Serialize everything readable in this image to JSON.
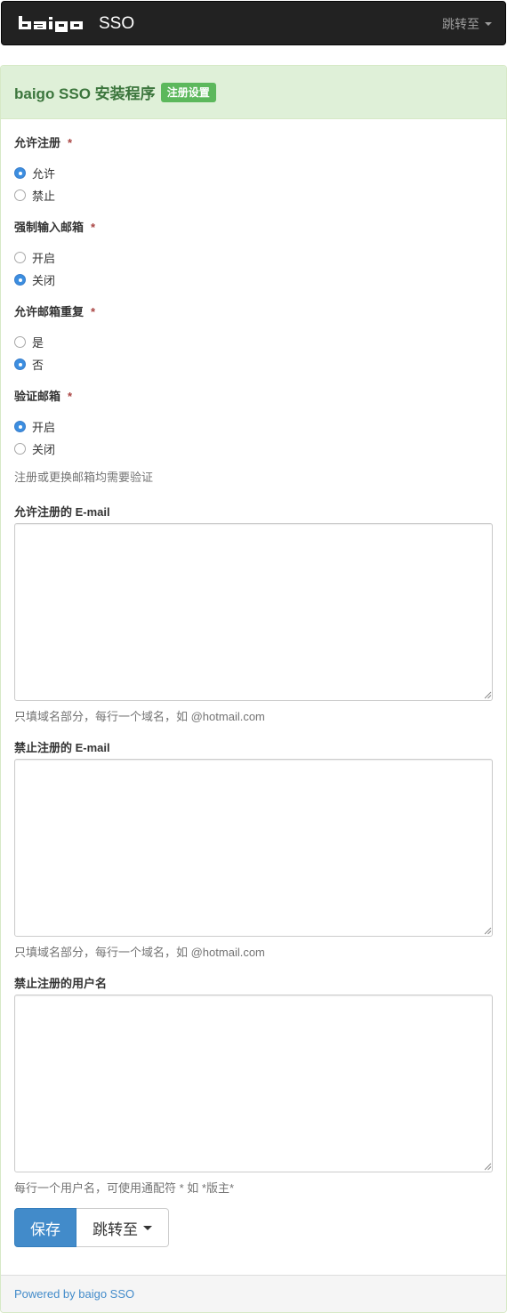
{
  "navbar": {
    "brand_text": "SSO",
    "logo_text": "baigo",
    "jump_label": "跳转至"
  },
  "panel": {
    "title": "baigo SSO 安装程序",
    "badge": "注册设置"
  },
  "fields": {
    "allow_reg": {
      "label": "允许注册",
      "required": "*",
      "options": [
        "允许",
        "禁止"
      ],
      "selected": "允许"
    },
    "force_email": {
      "label": "强制输入邮箱",
      "required": "*",
      "options": [
        "开启",
        "关闭"
      ],
      "selected": "关闭"
    },
    "allow_dup_email": {
      "label": "允许邮箱重复",
      "required": "*",
      "options": [
        "是",
        "否"
      ],
      "selected": "否"
    },
    "verify_email": {
      "label": "验证邮箱",
      "required": "*",
      "options": [
        "开启",
        "关闭"
      ],
      "selected": "开启",
      "help": "注册或更换邮箱均需要验证"
    },
    "allowed_emails": {
      "label": "允许注册的 E-mail",
      "value": "",
      "help": "只填域名部分，每行一个域名，如 @hotmail.com"
    },
    "banned_emails": {
      "label": "禁止注册的 E-mail",
      "value": "",
      "help": "只填域名部分，每行一个域名，如 @hotmail.com"
    },
    "banned_names": {
      "label": "禁止注册的用户名",
      "value": "",
      "help": "每行一个用户名，可使用通配符 * 如 *版主*"
    }
  },
  "actions": {
    "save_label": "保存",
    "jump_label": "跳转至"
  },
  "footer": {
    "link_text": "Powered by baigo SSO"
  },
  "colors": {
    "navbar_bg": "#222222",
    "panel_heading_bg": "#dff0d8",
    "panel_title": "#3c763d",
    "badge_bg": "#5cb85c",
    "primary": "#428bca",
    "required": "#a94442"
  }
}
